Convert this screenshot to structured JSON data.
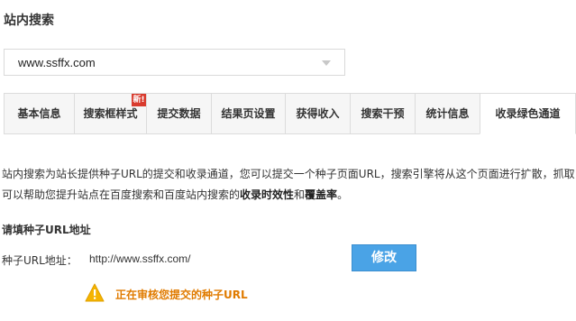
{
  "page": {
    "title": "站内搜索"
  },
  "site_select": {
    "value": "www.ssffx.com"
  },
  "tabs": [
    {
      "label": "基本信息"
    },
    {
      "label": "搜索框样式",
      "badge": "新!"
    },
    {
      "label": "提交数据"
    },
    {
      "label": "结果页设置"
    },
    {
      "label": "获得收入"
    },
    {
      "label": "搜索干预"
    },
    {
      "label": "统计信息"
    },
    {
      "label": "收录绿色通道",
      "active": true
    }
  ],
  "description": {
    "line1": "站内搜索为站长提供种子URL的提交和收录通道，您可以提交一个种子页面URL，搜索引擎将从这个页面进行扩散，抓取",
    "line2_prefix": "可以帮助您提升站点在百度搜索和百度站内搜索的",
    "line2_bold1": "收录时效性",
    "line2_mid": "和",
    "line2_bold2": "覆盖率",
    "line2_suffix": "。"
  },
  "form": {
    "section_title": "请填种子URL地址",
    "field_label": "种子URL地址：",
    "field_value": "http://www.ssffx.com/",
    "modify_button": "修改"
  },
  "status": {
    "icon": "warning-icon",
    "text": "正在审核您提交的种子URL",
    "color": "#e07b00"
  }
}
